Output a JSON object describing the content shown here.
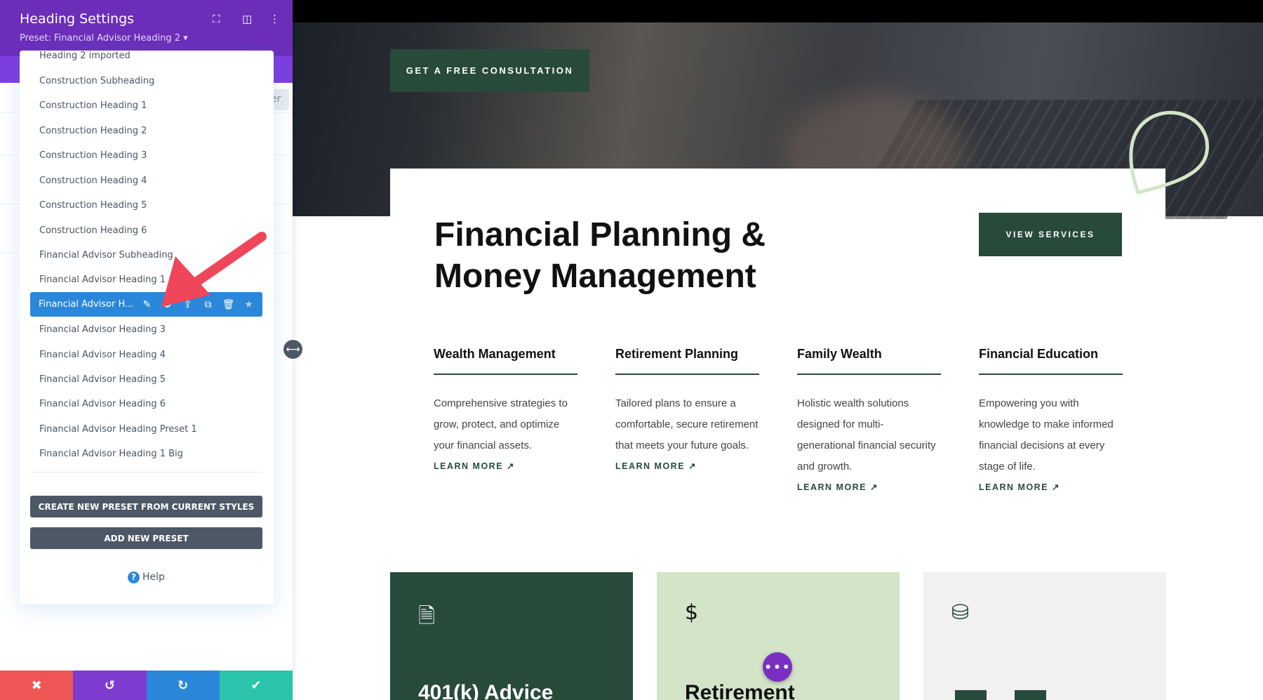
{
  "sidebar": {
    "title": "Heading Settings",
    "preset_label": "Preset: Financial Advisor Heading 2 ▾",
    "partial_button": "er",
    "presets": [
      "Heading 2 imported",
      "Construction Subheading",
      "Construction Heading 1",
      "Construction Heading 2",
      "Construction Heading 3",
      "Construction Heading 4",
      "Construction Heading 5",
      "Construction Heading 6",
      "Financial Advisor Subheading",
      "Financial Advisor Heading 1"
    ],
    "selected_preset": "Financial Advisor H...",
    "presets_after": [
      "Financial Advisor Heading 3",
      "Financial Advisor Heading 4",
      "Financial Advisor Heading 5",
      "Financial Advisor Heading 6",
      "Financial Advisor Heading Preset 1",
      "Financial Advisor Heading 1 Big"
    ],
    "create_btn": "CREATE NEW PRESET FROM CURRENT STYLES",
    "add_btn": "ADD NEW PRESET",
    "help": "Help",
    "colors": {
      "header": "#6c2eb9",
      "selected": "#2b87da",
      "cancel": "#ef5555",
      "undo": "#7e3bd0",
      "redo": "#2b87da",
      "save": "#29c4a9"
    }
  },
  "page": {
    "cta": "GET A FREE CONSULTATION",
    "title": "Financial Planning & Money Management",
    "view_services": "VIEW SERVICES",
    "columns": [
      {
        "title": "Wealth Management",
        "text": "Comprehensive strategies to grow, protect, and optimize your financial assets.",
        "link": "LEARN MORE ↗"
      },
      {
        "title": "Retirement Planning",
        "text": "Tailored plans to ensure a comfortable, secure retirement that meets your future goals.",
        "link": "LEARN MORE ↗"
      },
      {
        "title": "Family Wealth",
        "text": "Holistic wealth solutions designed for multi-generational financial security and growth.",
        "link": "LEARN MORE ↗"
      },
      {
        "title": "Financial Education",
        "text": "Empowering you with knowledge to make informed financial decisions at every stage of life.",
        "link": "LEARN MORE ↗"
      }
    ],
    "cards": [
      {
        "title": "401(k) Advice",
        "icon": "file-invoice-dollar-icon"
      },
      {
        "title": "Retirement",
        "icon": "hand-holding-dollar-icon"
      },
      {
        "title": "",
        "icon": "coins-icon"
      }
    ],
    "brand_color": "#274a3b"
  }
}
